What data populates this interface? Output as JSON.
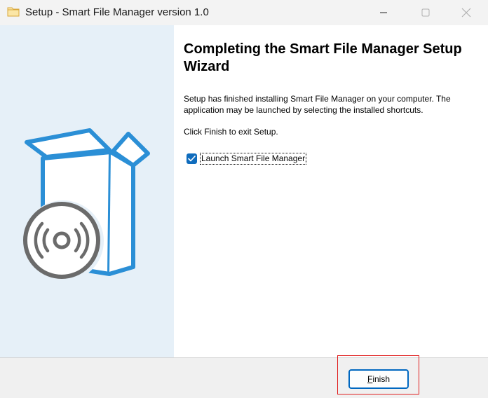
{
  "window": {
    "title": "Setup - Smart File Manager version 1.0",
    "icon": "folder-icon",
    "controls": [
      "minimize-icon",
      "maximize-icon",
      "close-icon"
    ]
  },
  "sidebar": {
    "illustration": "software-box-with-disc"
  },
  "main": {
    "heading": "Completing the Smart File Manager Setup Wizard",
    "paragraph1": "Setup has finished installing Smart File Manager on your computer. The application may be launched by selecting the installed shortcuts.",
    "paragraph2": "Click Finish to exit Setup.",
    "launch_checkbox": {
      "label": "Launch Smart File Manager",
      "checked": true
    }
  },
  "footer": {
    "finish_label_accel": "F",
    "finish_label_rest": "inish"
  },
  "colors": {
    "accent": "#0f6cbd",
    "sidebar_bg": "#e6f0f8",
    "box_blue": "#2b8fd6",
    "disc_gray": "#6b6b6b",
    "highlight_red": "#e02020"
  }
}
